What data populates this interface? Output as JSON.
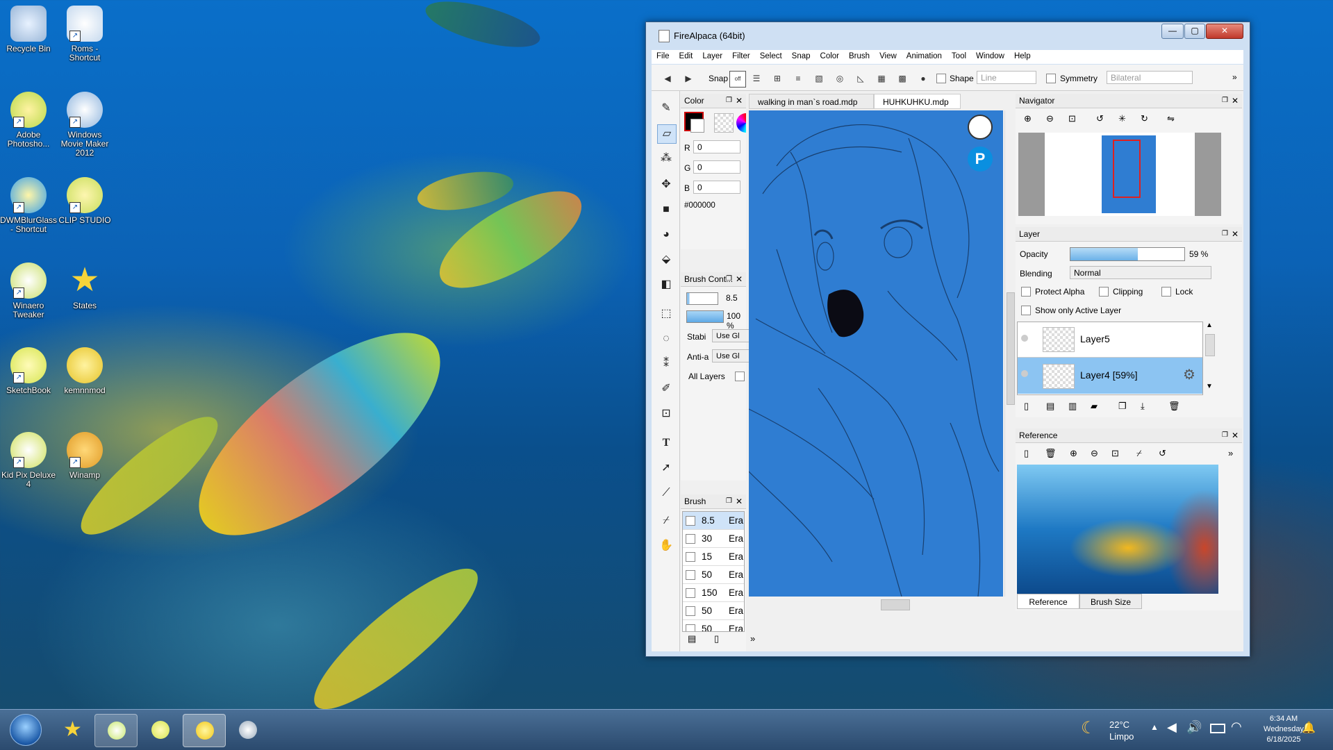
{
  "desktop": {
    "icons": [
      {
        "label": "Recycle Bin"
      },
      {
        "label": "Roms - Shortcut"
      },
      {
        "label": "Adobe Photosho..."
      },
      {
        "label": "Windows Movie Maker 2012"
      },
      {
        "label": "DWMBlurGlass - Shortcut"
      },
      {
        "label": "CLIP STUDIO"
      },
      {
        "label": "Winaero Tweaker"
      },
      {
        "label": "States"
      },
      {
        "label": "SketchBook"
      },
      {
        "label": "kemnnmod"
      },
      {
        "label": "Kid Pix Deluxe 4"
      },
      {
        "label": "Winamp"
      }
    ]
  },
  "window": {
    "title": "FireAlpaca (64bit)",
    "controls": {
      "minimize": "—",
      "maximize": "▢",
      "close": "✕"
    },
    "menu": [
      "File",
      "Edit",
      "Layer",
      "Filter",
      "Select",
      "Snap",
      "Color",
      "Brush",
      "View",
      "Animation",
      "Tool",
      "Window",
      "Help"
    ],
    "toolbar": {
      "snap_label": "Snap",
      "shape_label": "Shape",
      "shape_value": "Line",
      "symmetry_label": "Symmetry",
      "symmetry_value": "Bilateral",
      "more": "»"
    }
  },
  "color_panel": {
    "title": "Color",
    "r_label": "R",
    "r_value": "0",
    "g_label": "G",
    "g_value": "0",
    "b_label": "B",
    "b_value": "0",
    "hex": "#000000",
    "swatch": "#000000"
  },
  "brush_control": {
    "title": "Brush Cont...",
    "size_value": "8.5",
    "opacity_value": "100 %",
    "stabilizer_label": "Stabi",
    "stabilizer_value": "Use Gl",
    "antialias_label": "Anti-a",
    "antialias_value": "Use Gl",
    "all_layers_label": "All Layers"
  },
  "brush_panel": {
    "title": "Brush",
    "items": [
      {
        "size": "8.5",
        "name": "Era"
      },
      {
        "size": "30",
        "name": "Era"
      },
      {
        "size": "15",
        "name": "Era"
      },
      {
        "size": "50",
        "name": "Era"
      },
      {
        "size": "150",
        "name": "Era"
      },
      {
        "size": "50",
        "name": "Era"
      },
      {
        "size": "50",
        "name": "Era"
      }
    ],
    "more": "»"
  },
  "tabs": [
    {
      "label": "walking in man`s road.mdp"
    },
    {
      "label": "HUHKUHKU.mdp"
    }
  ],
  "navigator": {
    "title": "Navigator"
  },
  "layer_panel": {
    "title": "Layer",
    "opacity_label": "Opacity",
    "opacity_value": "59 %",
    "opacity_fraction": 0.59,
    "blending_label": "Blending",
    "blending_value": "Normal",
    "protect_alpha_label": "Protect Alpha",
    "clipping_label": "Clipping",
    "lock_label": "Lock",
    "show_active_label": "Show only Active Layer",
    "layers": [
      {
        "name": "Layer5"
      },
      {
        "name": "Layer4 [59%]"
      }
    ]
  },
  "reference_panel": {
    "title": "Reference",
    "tab_reference": "Reference",
    "tab_brush_size": "Brush Size"
  },
  "taskbar": {
    "weather_temp": "22°C",
    "weather_desc": "Limpo",
    "time": "6:34 AM",
    "day": "Wednesday",
    "date": "6/18/2025"
  }
}
